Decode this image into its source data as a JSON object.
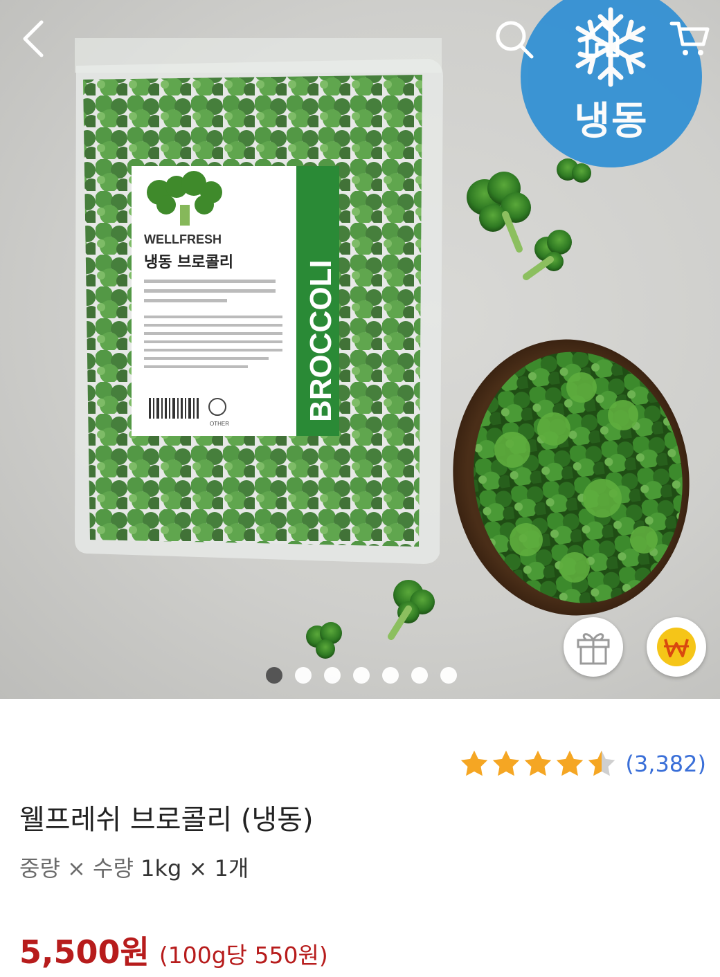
{
  "nav": {
    "back_icon": "chevron-left-icon",
    "search_icon": "search-icon",
    "home_icon": "home-icon",
    "cart_icon": "cart-icon"
  },
  "hero": {
    "badge_label": "냉동",
    "badge_icon": "snowflake-icon",
    "badge_color": "#2f8fd4",
    "package": {
      "brand": "WELLFRESH",
      "name": "냉동 브로콜리",
      "side_text": "BROCCOLI",
      "recycle": "OTHER"
    },
    "gift_icon": "gift-icon",
    "reward_icon": "won-coin-icon",
    "carousel": {
      "total": 7,
      "active": 1
    }
  },
  "product": {
    "rating": 4.5,
    "review_count": "(3,382)",
    "title": "웰프레쉬 브로콜리 (냉동)",
    "spec_label": "중량 × 수량",
    "spec_value": "1kg × 1개",
    "price": "5,500원",
    "unit_price": "(100g당 550원)"
  },
  "colors": {
    "price": "#b71c1c",
    "review_link": "#3a6fd8",
    "star": "#f5a623"
  }
}
